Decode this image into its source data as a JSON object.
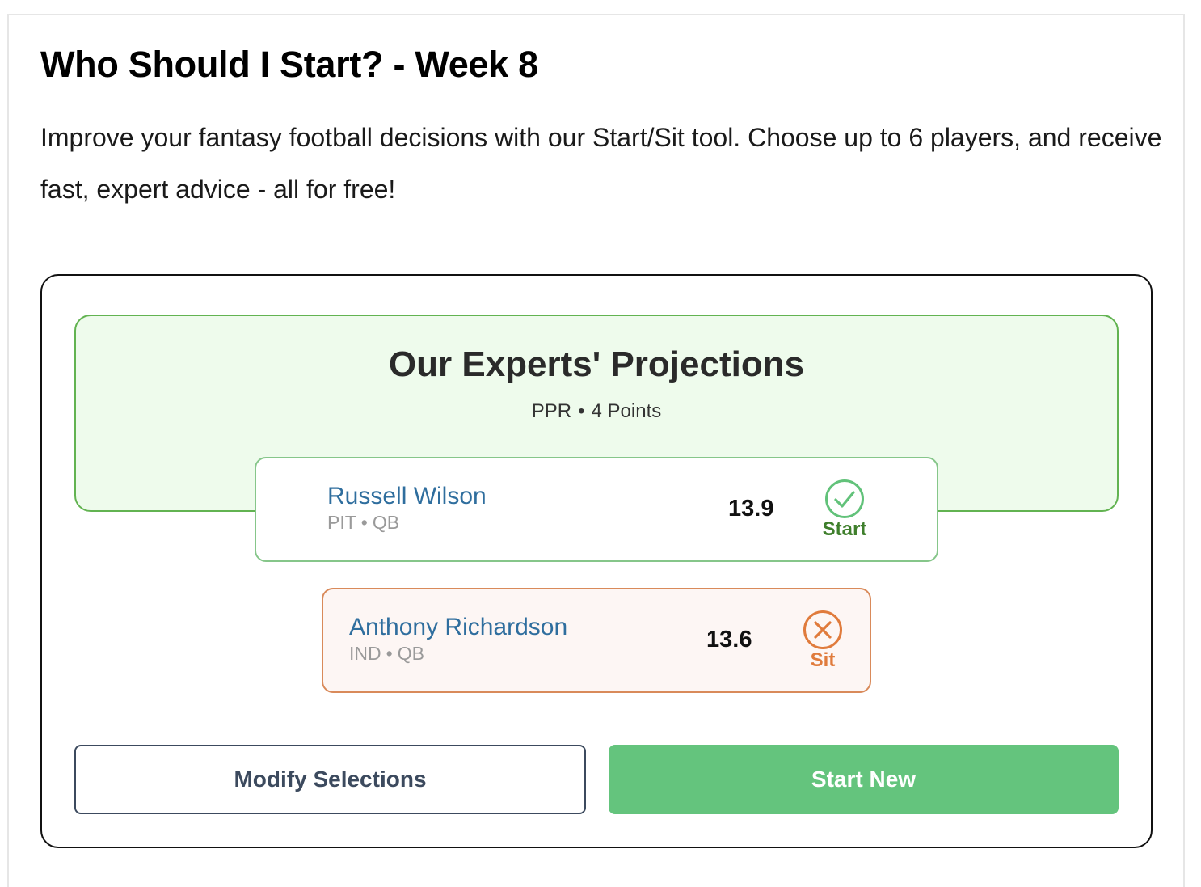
{
  "page": {
    "title": "Who Should I Start? - Week 8",
    "intro": "Improve your fantasy football decisions with our Start/Sit tool. Choose up to 6 players, and receive fast, expert advice - all for free!"
  },
  "projections": {
    "title": "Our Experts' Projections",
    "scoring": "PPR",
    "separator": "•",
    "points_setting": "4 Points"
  },
  "players": [
    {
      "name": "Russell Wilson",
      "team": "PIT",
      "separator": "•",
      "position": "QB",
      "points": "13.9",
      "verdict": "Start",
      "verdict_icon": "check-circle-icon",
      "color": "#3f7f2c"
    },
    {
      "name": "Anthony Richardson",
      "team": "IND",
      "separator": "•",
      "position": "QB",
      "points": "13.6",
      "verdict": "Sit",
      "verdict_icon": "x-circle-icon",
      "color": "#e07b3c"
    }
  ],
  "actions": {
    "modify_label": "Modify Selections",
    "new_label": "Start New"
  },
  "colors": {
    "start_green": "#62b351",
    "sit_orange": "#d98a5a",
    "primary_button": "#64c47d",
    "name_blue": "#2f6e9e"
  }
}
